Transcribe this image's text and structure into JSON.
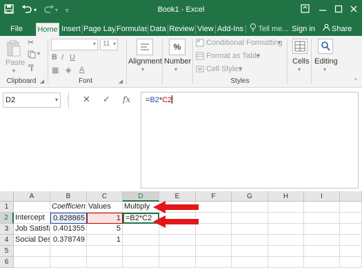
{
  "titlebar": {
    "title": "Book1 - Excel"
  },
  "tabs": [
    {
      "label": "File"
    },
    {
      "label": "Home"
    },
    {
      "label": "Insert"
    },
    {
      "label": "Page Layo"
    },
    {
      "label": "Formulas"
    },
    {
      "label": "Data"
    },
    {
      "label": "Review"
    },
    {
      "label": "View"
    },
    {
      "label": "Add-Ins"
    },
    {
      "label": "Tell me..."
    },
    {
      "label": "Sign in"
    },
    {
      "label": "Share"
    }
  ],
  "ribbon": {
    "clipboard": {
      "paste": "Paste",
      "group": "Clipboard"
    },
    "font": {
      "size": "11",
      "group": "Font"
    },
    "alignment": {
      "label": "Alignment"
    },
    "number": {
      "label": "Number",
      "symbol": "%"
    },
    "styles": {
      "conditional": "Conditional Formatting",
      "format_table": "Format as Table",
      "cell_styles": "Cell Styles",
      "group": "Styles"
    },
    "cells": {
      "label": "Cells"
    },
    "editing": {
      "label": "Editing"
    }
  },
  "formula_bar": {
    "name_box": "D2",
    "formula_prefix": "=",
    "ref1": "B2",
    "op": "*",
    "ref2": "C2"
  },
  "columns": [
    "A",
    "B",
    "C",
    "D",
    "E",
    "F",
    "G",
    "H",
    "I"
  ],
  "rows": [
    "1",
    "2",
    "3",
    "4",
    "5",
    "6"
  ],
  "cells": {
    "B1": "Coefficien",
    "C1": "Values",
    "D1": "Multiply",
    "A2": "Intercept",
    "B2": "0.828865",
    "C2": "1",
    "D2": "=B2*C2",
    "A3": "Job Satisfa",
    "B3": "0.401355",
    "C3": "5",
    "A4": "Social Des",
    "B4": "0.378749",
    "C4": "1"
  },
  "colors": {
    "brand": "#217346",
    "arrow": "#e3161a",
    "ref_blue": "#1f4e9c",
    "ref_red": "#c00000"
  }
}
